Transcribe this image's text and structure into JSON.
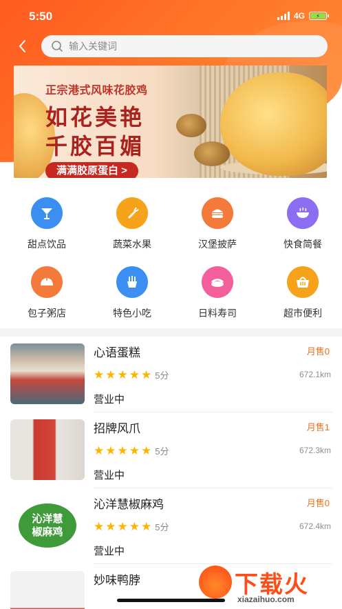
{
  "status_bar": {
    "time": "5:50",
    "network": "4G"
  },
  "search": {
    "placeholder": "输入关键词"
  },
  "banner": {
    "subtitle": "正宗港式风味花胶鸡",
    "title_line1": "如花美艳",
    "title_line2": "千胶百媚",
    "cta": "满满胶原蛋白 >"
  },
  "categories": [
    {
      "label": "甜点饮品",
      "icon": "cocktail-icon",
      "color": "#3a8ff0"
    },
    {
      "label": "蔬菜水果",
      "icon": "carrot-icon",
      "color": "#f7a21b"
    },
    {
      "label": "汉堡披萨",
      "icon": "burger-icon",
      "color": "#f47a3c"
    },
    {
      "label": "快食简餐",
      "icon": "bowl-icon",
      "color": "#8b6ef2"
    },
    {
      "label": "包子粥店",
      "icon": "bun-icon",
      "color": "#f47a3c"
    },
    {
      "label": "特色小吃",
      "icon": "fries-icon",
      "color": "#3a8ff0"
    },
    {
      "label": "日料寿司",
      "icon": "sushi-icon",
      "color": "#f25f9a"
    },
    {
      "label": "超市便利",
      "icon": "basket-icon",
      "color": "#f7a21b"
    }
  ],
  "shops": [
    {
      "name": "心语蛋糕",
      "sales": "月售0",
      "rating": 5,
      "score": "5分",
      "distance": "672.1km",
      "state": "营业中",
      "thumb_text": ""
    },
    {
      "name": "招牌风爪",
      "sales": "月售1",
      "rating": 5,
      "score": "5分",
      "distance": "672.3km",
      "state": "营业中",
      "thumb_text": ""
    },
    {
      "name": "沁洋慧椒麻鸡",
      "sales": "月售0",
      "rating": 5,
      "score": "5分",
      "distance": "672.4km",
      "state": "营业中",
      "thumb_text": "沁洋慧\n椒麻鸡"
    },
    {
      "name": "妙味鸭脖",
      "sales": "",
      "rating": 0,
      "score": "",
      "distance": "",
      "state": "",
      "thumb_text": ""
    }
  ],
  "watermark": {
    "title": "下载火",
    "url": "xiazaihuo.com"
  },
  "colors": {
    "primary": "#ff6a22",
    "sales": "#e8731e",
    "star": "#ffb400"
  }
}
